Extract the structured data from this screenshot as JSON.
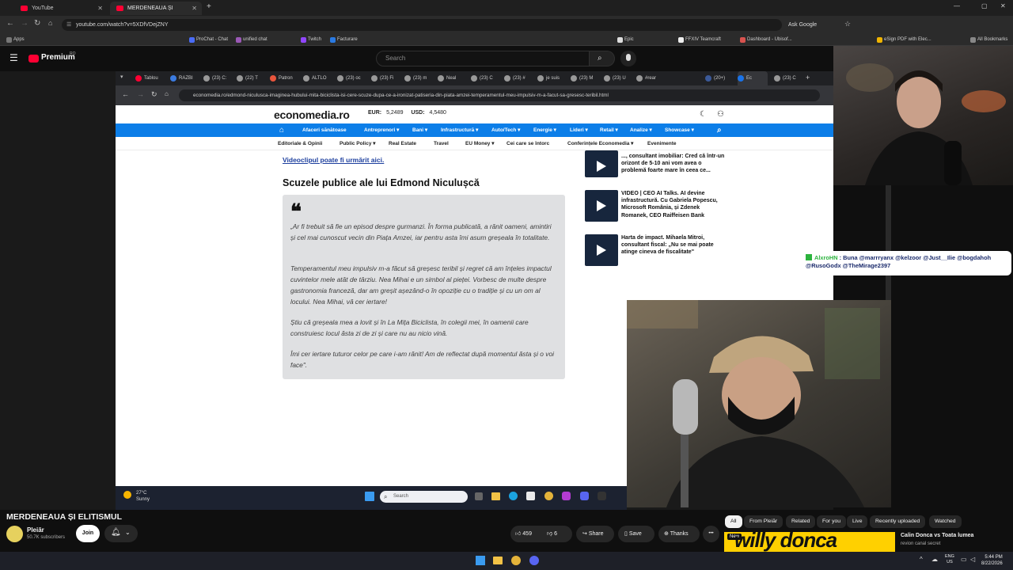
{
  "browser_tabs": [
    {
      "title": "YouTube",
      "active": false
    },
    {
      "title": "MERDENEAUA ȘI ELITISMUL",
      "active": true
    }
  ],
  "address_bar": {
    "url": "youtube.com/watch?v=5XDfVDejZNY",
    "profile_label": "Ask Google"
  },
  "bookmarks": [
    "Apps",
    "ProChat - Chat",
    "unified chat",
    "Twitch",
    "Facturare",
    "Epic",
    "FFXIV Teamcraft",
    "Dashboard - Ubisof...",
    "eSign PDF with Elec...",
    "All Bookmarks"
  ],
  "youtube_header": {
    "brand": "Premium",
    "region": "RO",
    "search_placeholder": "Search"
  },
  "inner_browser": {
    "tabs": [
      "Tablou",
      "RAZBI",
      "(23) C:",
      "(22) T",
      "Patron",
      "ALTLO",
      "(23) oc",
      "(23) Fi",
      "(23) m",
      "Neal",
      "(23) C",
      "(23) #",
      "je suis",
      "(23) M",
      "(23) U",
      "#rear",
      "(20+)",
      "Ec",
      "(23) C"
    ],
    "url": "economedia.ro/edmond-niculusca-imaginea-hubului-mita-biciclista-isi-cere-scuze-dupa-ce-a-ironizat-patiseria-din-piata-amzei-temperamentul-meu-impulsiv-m-a-facut-sa-gresesc-teribil.html"
  },
  "economedia": {
    "logo": "economedia.ro",
    "eur_label": "EUR:",
    "eur_value": "5,2489",
    "usd_label": "USD:",
    "usd_value": "4,5480",
    "nav": [
      "Afaceri sănătoase",
      "Antreprenori ▾",
      "Bani ▾",
      "Infrastructură ▾",
      "Auto/Tech ▾",
      "Energie ▾",
      "Lideri ▾",
      "Retail ▾",
      "Analize ▾",
      "Showcase ▾"
    ],
    "subnav": [
      "Editoriale & Opinii",
      "Public Policy ▾",
      "Real Estate",
      "Travel",
      "EU Money ▾",
      "Cei care se întorc",
      "Conferințele Economedia ▾",
      "Evenimente"
    ],
    "video_link": "Videoclipul poate fi urmărit aici.",
    "section_title": "Scuzele publice ale lui Edmond Niculușcă",
    "quote_mark": "❝",
    "quote_paragraphs": [
      "„Ar fi trebuit să fie un episod despre gurmanzi. În forma publicată, a rănit oameni, amintiri și cel mai cunoscut vecin din Piața Amzei, iar pentru asta îmi asum greșeala în totalitate.",
      "Temperamentul meu impulsiv m-a făcut să greșesc teribil și regret că am înțeles impactul cuvintelor mele atât de târziu. Nea Mihai e un simbol al pieței. Vorbesc de multe despre gastronomia franceză, dar am greșit așezând-o în opoziție cu o tradiție și cu un om al locului. Nea Mihai, vă cer iertare!",
      "Știu că greșeala mea a lovit și în La Mița Biciclista, în colegii mei, în oamenii care construiesc locul ăsta zi de zi și care nu au nicio vină.",
      "Îmi cer iertare tuturor celor pe care i-am rănit! Am de reflectat după momentul ăsta și o voi face\"."
    ],
    "side_articles": [
      "..., consultant imobiliar: Cred că într-un orizont de 5-10 ani vom avea o problemă foarte mare în ceea ce...",
      "VIDEO | CEO AI Talks. AI devine infrastructură. Cu Gabriela Popescu, Microsoft România, și Zdenek Romanek, CEO Raiffeisen Bank",
      "Harta de impact. Mihaela Mitroi, consultant fiscal: „Nu se mai poate atinge cineva de fiscalitate\""
    ]
  },
  "inner_taskbar": {
    "temp": "27°C",
    "weather": "Sunny",
    "search": "Search"
  },
  "chat_overlay": {
    "username": "AlxroHN",
    "colon": " : ",
    "message": "Buna @marrryanx @kelzoor @Just__Ilie @bogdahoh @RusoGodx @TheMirage2397"
  },
  "video": {
    "title": "MERDENEAUA ȘI ELITISMUL",
    "channel": "Pleiăr",
    "subscribers": "50.7K subscribers",
    "join": "Join",
    "likes": "459",
    "dislikes": "6",
    "share": "Share",
    "save": "Save",
    "thanks": "Thanks",
    "more": "•••"
  },
  "recommend_chips": [
    "All",
    "From Pleiăr",
    "Related",
    "For you",
    "Live",
    "Recently uploaded",
    "Watched"
  ],
  "recommendation": {
    "badge": "New",
    "thumb_text": "willy donca",
    "title": "Calin Donca vs Toata lumea",
    "channel": "revion canal secret"
  },
  "system_tray": {
    "lang_top": "ENG",
    "lang_bottom": "US",
    "time": "5:44 PM",
    "date": "8/22/2026"
  },
  "colors": {
    "economedia_nav": "#0c7ee8",
    "yt_red": "#ff0033",
    "chat_name": "#2cb33e"
  }
}
